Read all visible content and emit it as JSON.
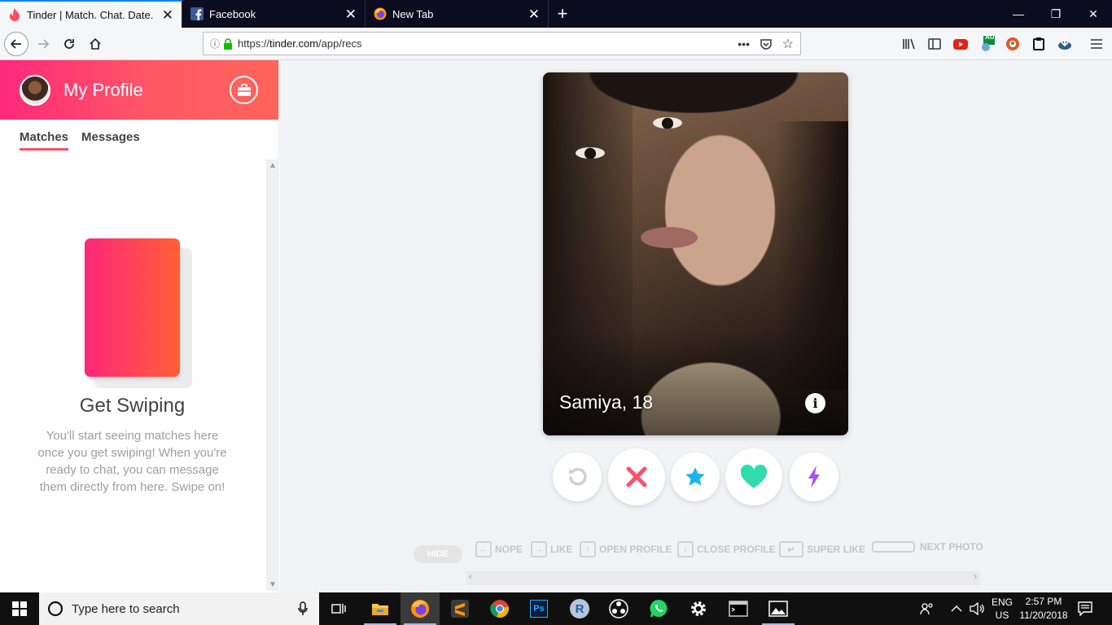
{
  "browser": {
    "tabs": [
      {
        "title": "Tinder | Match. Chat. Date.",
        "active": true
      },
      {
        "title": "Facebook",
        "active": false
      },
      {
        "title": "New Tab",
        "active": false
      }
    ],
    "url_prefix": "https://",
    "url_host": "tinder.com",
    "url_path": "/app/recs",
    "extension_badge": "AU"
  },
  "sidebar": {
    "profile_title": "My Profile",
    "tabs": [
      {
        "label": "Matches",
        "active": true
      },
      {
        "label": "Messages",
        "active": false
      }
    ],
    "empty_title": "Get Swiping",
    "empty_text": "You'll start seeing matches here once you get swiping! When you're ready to chat, you can message them directly from here. Swipe on!"
  },
  "card": {
    "name_age": "Samiya, 18"
  },
  "actions": [
    "rewind-icon",
    "nope-icon",
    "super-like-icon",
    "like-icon",
    "boost-icon"
  ],
  "colors": {
    "brand_gradient_start": "#fd297b",
    "brand_gradient_end": "#ff655b",
    "nope": "#fd5068",
    "super_like": "#1ab4f4",
    "like": "#23e2a6",
    "boost": "#a84ff0"
  },
  "hints": {
    "hide": "HIDE",
    "nope": "NOPE",
    "like": "LIKE",
    "open_profile": "OPEN PROFILE",
    "close_profile": "CLOSE PROFILE",
    "super_like": "SUPER LIKE",
    "next_photo": "NEXT PHOTO"
  },
  "taskbar": {
    "search_placeholder": "Type here to search",
    "lang_top": "ENG",
    "lang_bottom": "US",
    "time": "2:57 PM",
    "date": "11/20/2018",
    "photoshop_label": "Ps",
    "r_label": "R"
  }
}
